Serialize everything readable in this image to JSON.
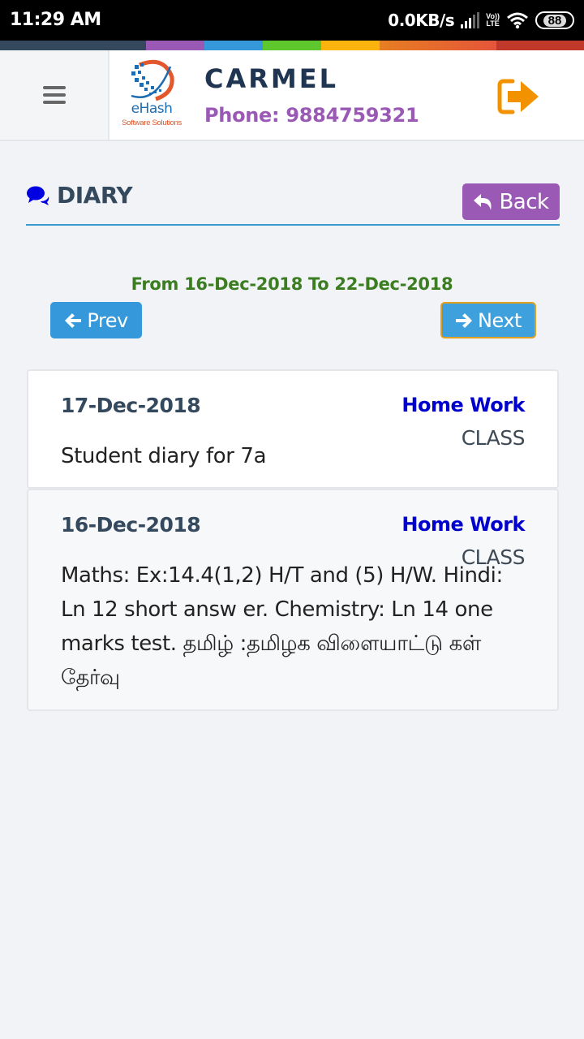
{
  "status_bar": {
    "time": "11:29 AM",
    "network_speed": "0.0KB/s",
    "volte_top": "Vo))",
    "volte_bottom": "LTE",
    "battery": "88",
    "icons": [
      "signal-icon",
      "volte-icon",
      "wifi-icon",
      "battery-icon"
    ]
  },
  "stripe_colors": [
    "#34495e",
    "#9b59b6",
    "#3498db",
    "#5ec72e",
    "#fbb40e",
    "#e67e22",
    "#c0392b"
  ],
  "header": {
    "menu_icon": "hamburger-icon",
    "logo_text": "eHash",
    "logo_subtext": "Software Solutions",
    "school_name": "CARMEL",
    "phone": "Phone: 9884759321",
    "logout_icon": "sign-out-icon"
  },
  "page": {
    "title": "DIARY",
    "title_icon": "comments-icon",
    "back_label": "Back",
    "back_icon": "reply-icon"
  },
  "range": {
    "text": "From 16-Dec-2018 To 22-Dec-2018",
    "prev_label": "Prev",
    "next_label": "Next"
  },
  "entries": [
    {
      "date": "17-Dec-2018",
      "type": "Home Work",
      "category": "CLASS",
      "body": "Student diary for 7a"
    },
    {
      "date": "16-Dec-2018",
      "type": "Home Work",
      "category": "CLASS",
      "body": "Maths: Ex:14.4(1,2) H/T and (5) H/W. Hindi: Ln 12 short answ er. Chemistry: Ln 14 one marks test. தமிழ் :தமிழக விளையாட்டு கள் தேர்வு"
    }
  ],
  "colors": {
    "accent_blue": "#3498db",
    "accent_purple": "#9b59b6",
    "range_green": "#3c7d22",
    "type_blue": "#0000cc",
    "logout_orange": "#f39200"
  }
}
